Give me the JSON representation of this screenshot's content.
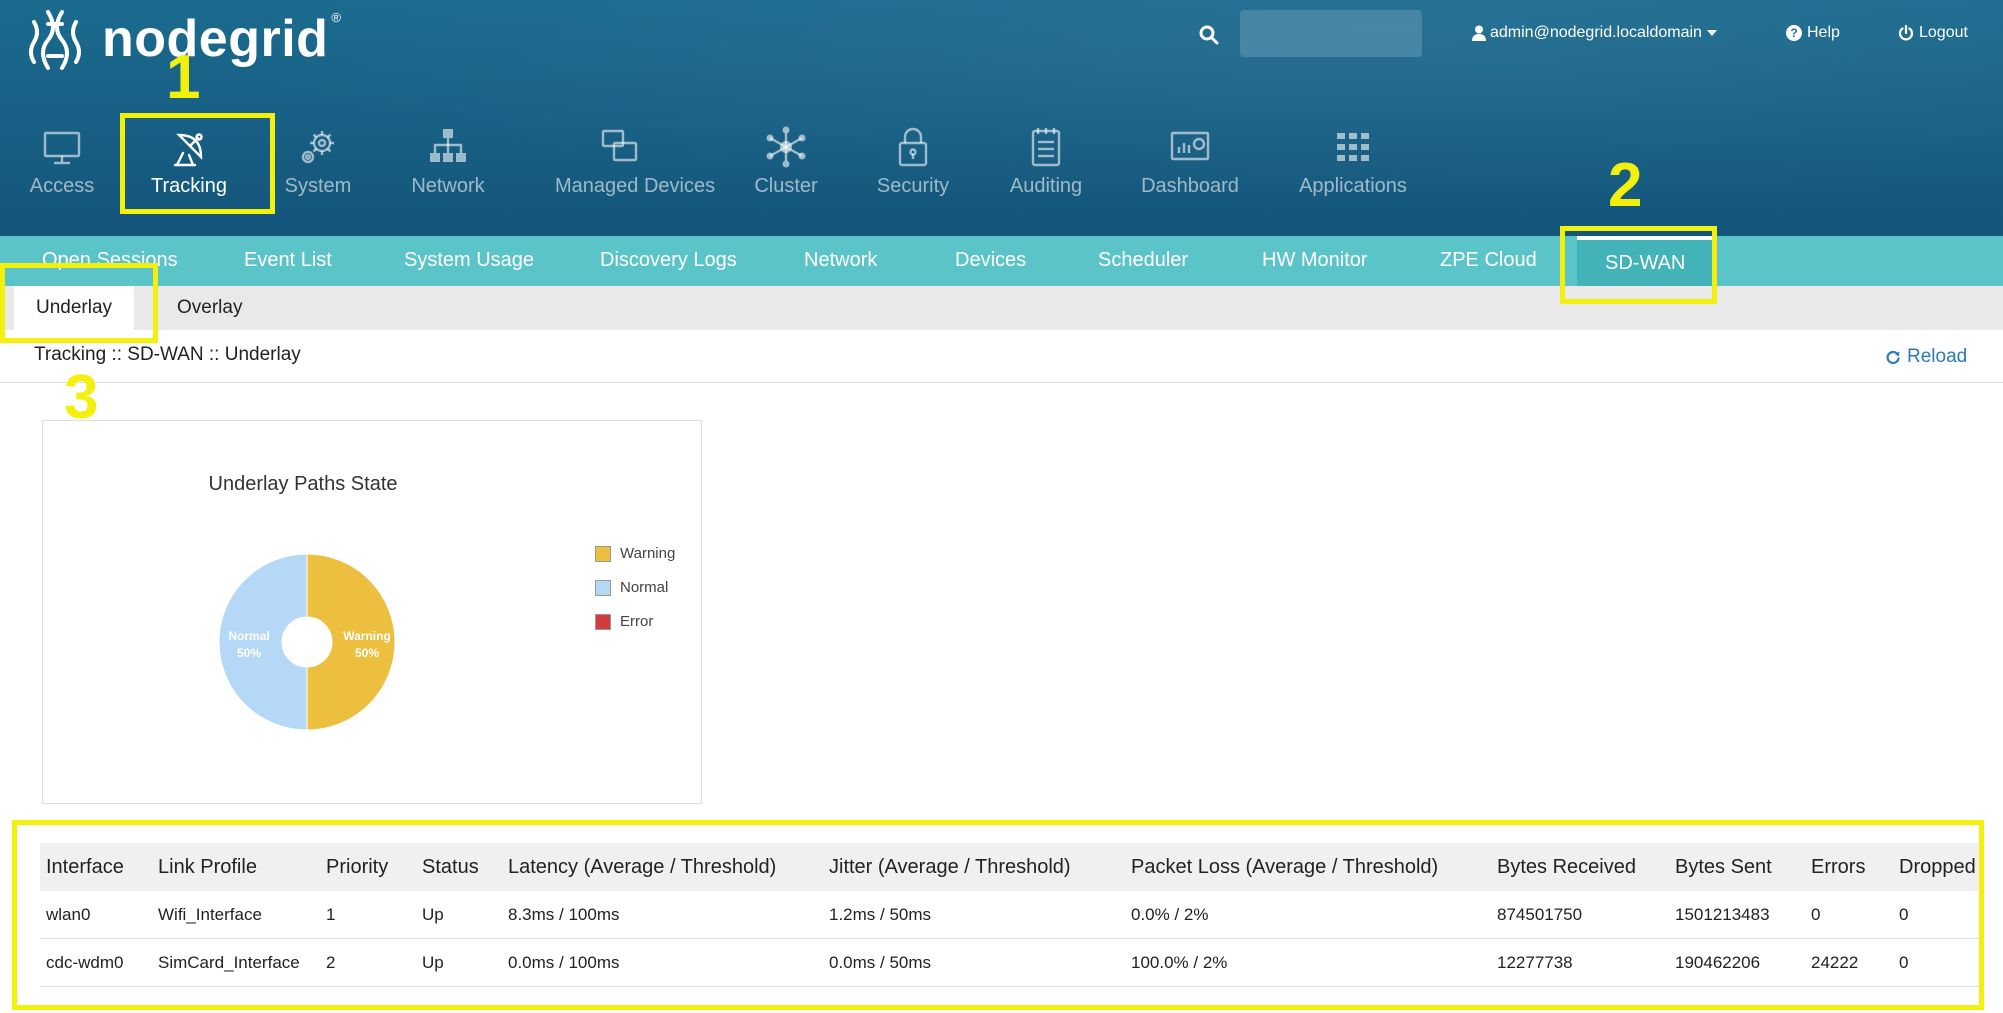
{
  "header": {
    "logo_text": "nodegrid",
    "logo_reg": "®",
    "user": "admin@nodegrid.localdomain",
    "help_label": "Help",
    "logout_label": "Logout"
  },
  "mainnav": [
    {
      "label": "Access",
      "icon": "monitor-icon"
    },
    {
      "label": "Tracking",
      "icon": "satellite-dish-icon",
      "active": true
    },
    {
      "label": "System",
      "icon": "gears-icon"
    },
    {
      "label": "Network",
      "icon": "network-tree-icon"
    },
    {
      "label": "Managed Devices",
      "icon": "devices-icon"
    },
    {
      "label": "Cluster",
      "icon": "cluster-icon"
    },
    {
      "label": "Security",
      "icon": "lock-icon"
    },
    {
      "label": "Auditing",
      "icon": "notepad-icon"
    },
    {
      "label": "Dashboard",
      "icon": "dashboard-icon"
    },
    {
      "label": "Applications",
      "icon": "grid-icon"
    }
  ],
  "tabs": [
    {
      "label": "Open Sessions"
    },
    {
      "label": "Event List"
    },
    {
      "label": "System Usage"
    },
    {
      "label": "Discovery Logs"
    },
    {
      "label": "Network"
    },
    {
      "label": "Devices"
    },
    {
      "label": "Scheduler"
    },
    {
      "label": "HW Monitor"
    },
    {
      "label": "ZPE Cloud"
    },
    {
      "label": "SD-WAN",
      "active": true
    }
  ],
  "subtabs": [
    {
      "label": "Underlay",
      "active": true
    },
    {
      "label": "Overlay"
    }
  ],
  "breadcrumb": "Tracking :: SD-WAN :: Underlay",
  "reload_label": "Reload",
  "chart_data": {
    "type": "pie",
    "donut": true,
    "title": "Underlay Paths State",
    "categories": [
      "Warning",
      "Normal",
      "Error"
    ],
    "values": [
      50,
      50,
      0
    ],
    "colors": [
      "#ecbf3f",
      "#b4d8f5",
      "#d23c3c"
    ],
    "slice_labels": [
      {
        "name": "Warning",
        "pct": "50%"
      },
      {
        "name": "Normal",
        "pct": "50%"
      }
    ],
    "legend_position": "right"
  },
  "table": {
    "columns": [
      "Interface",
      "Link Profile",
      "Priority",
      "Status",
      "Latency (Average / Threshold)",
      "Jitter (Average / Threshold)",
      "Packet Loss (Average / Threshold)",
      "Bytes Received",
      "Bytes Sent",
      "Errors",
      "Dropped"
    ],
    "rows": [
      [
        "wlan0",
        "Wifi_Interface",
        "1",
        "Up",
        "8.3ms / 100ms",
        "1.2ms / 50ms",
        "0.0% / 2%",
        "874501750",
        "1501213483",
        "0",
        "0"
      ],
      [
        "cdc-wdm0",
        "SimCard_Interface",
        "2",
        "Up",
        "0.0ms / 100ms",
        "0.0ms / 50ms",
        "100.0% / 2%",
        "12277738",
        "190462206",
        "24222",
        "0"
      ]
    ]
  },
  "annotations": {
    "num1": "1",
    "num2": "2",
    "num3": "3",
    "color": "#f4f00e"
  }
}
